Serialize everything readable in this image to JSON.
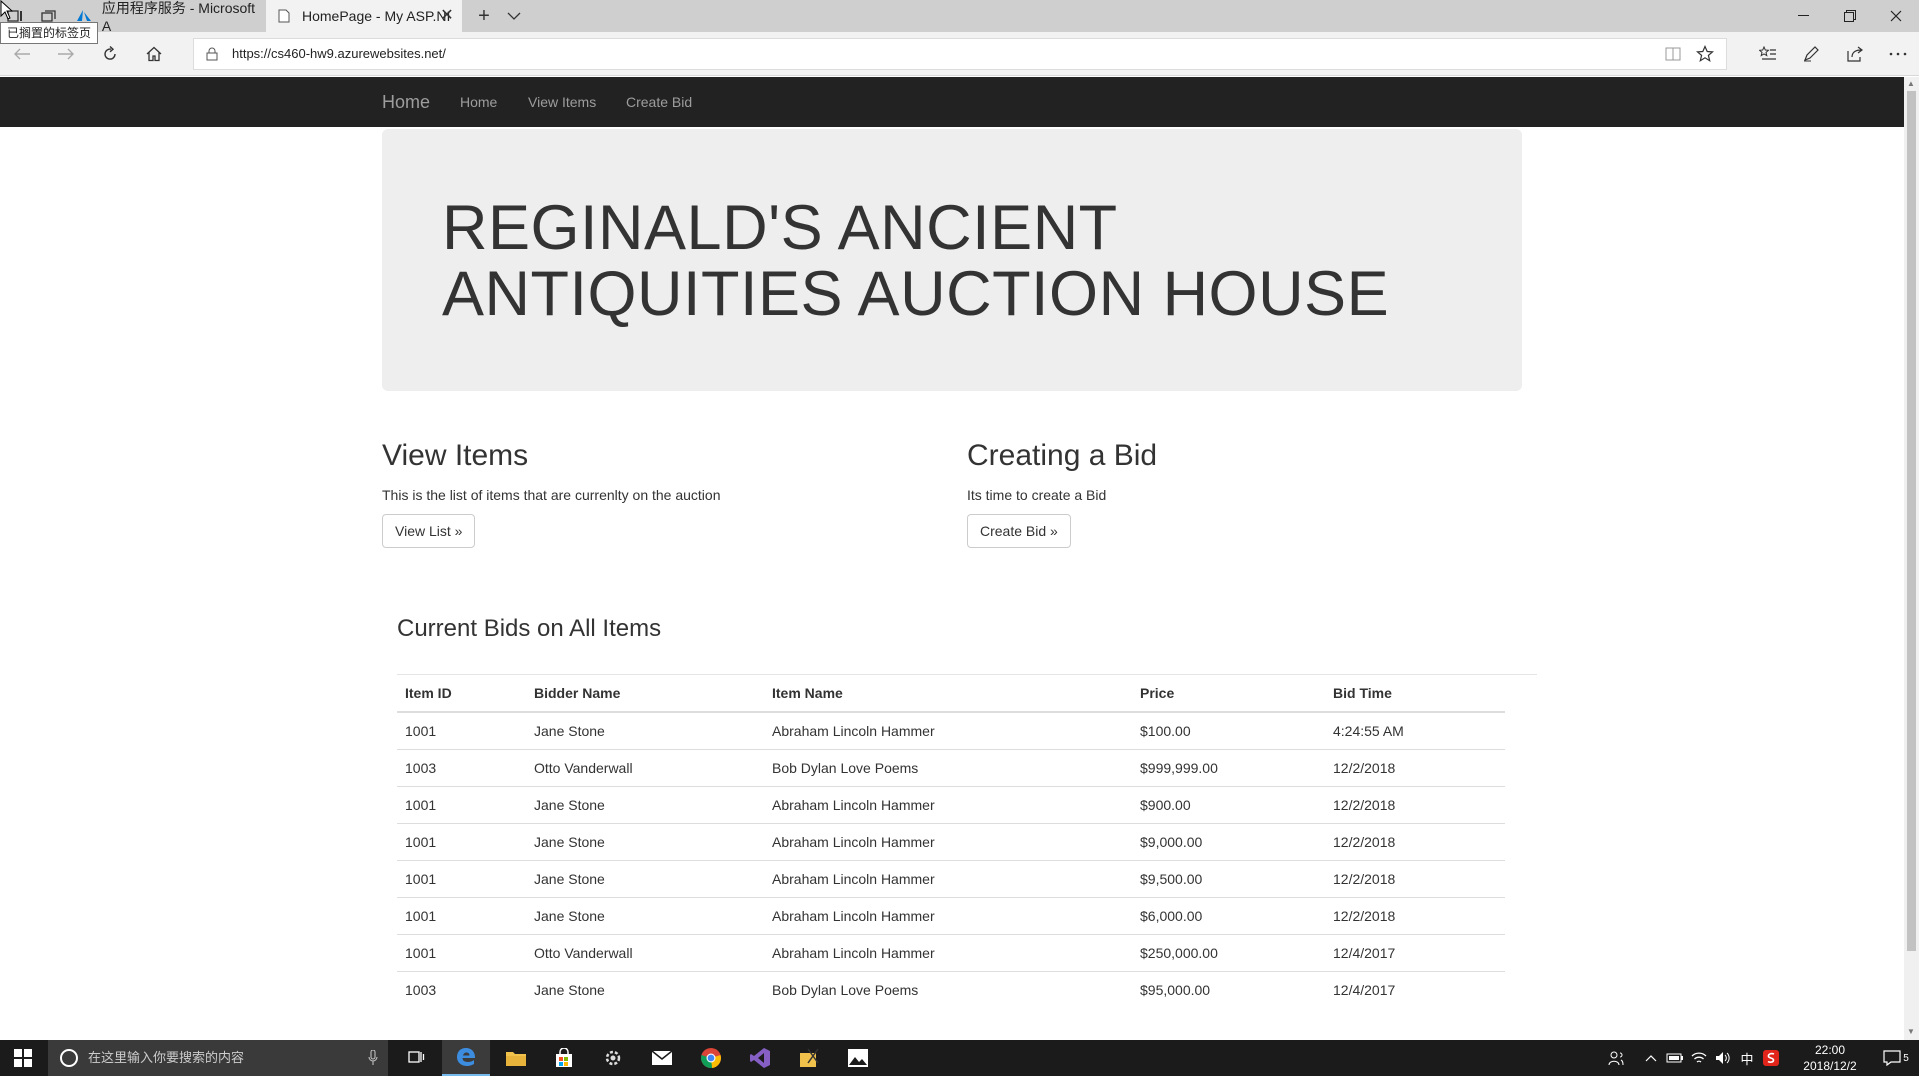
{
  "browser": {
    "tooltip": "已搁置的标签页",
    "tabs": [
      {
        "title": "应用程序服务 - Microsoft A",
        "icon": "azure-icon",
        "active": false
      },
      {
        "title": "HomePage - My ASP.NI",
        "icon": "page-icon",
        "active": true
      }
    ],
    "url": "https://cs460-hw9.azurewebsites.net/"
  },
  "site": {
    "brand": "Home",
    "nav_links": [
      "Home",
      "View Items",
      "Create Bid"
    ],
    "jumbotron_title": "REGINALD'S ANCIENT ANTIQUITIES AUCTION HOUSE",
    "view_items": {
      "heading": "View Items",
      "text": "This is the list of items that are currenlty on the auction",
      "button": "View List »"
    },
    "creating_bid": {
      "heading": "Creating a Bid",
      "text": "Its time to create a Bid",
      "button": "Create Bid »"
    },
    "bids": {
      "title": "Current Bids on All Items",
      "headers": [
        "Item ID",
        "Bidder Name",
        "Item Name",
        "Price",
        "Bid Time"
      ],
      "rows": [
        [
          "1001",
          "Jane Stone",
          "Abraham Lincoln Hammer",
          "$100.00",
          "4:24:55 AM"
        ],
        [
          "1003",
          "Otto Vanderwall",
          "Bob Dylan Love Poems",
          "$999,999.00",
          "12/2/2018"
        ],
        [
          "1001",
          "Jane Stone",
          "Abraham Lincoln Hammer",
          "$900.00",
          "12/2/2018"
        ],
        [
          "1001",
          "Jane Stone",
          "Abraham Lincoln Hammer",
          "$9,000.00",
          "12/2/2018"
        ],
        [
          "1001",
          "Jane Stone",
          "Abraham Lincoln Hammer",
          "$9,500.00",
          "12/2/2018"
        ],
        [
          "1001",
          "Jane Stone",
          "Abraham Lincoln Hammer",
          "$6,000.00",
          "12/2/2018"
        ],
        [
          "1001",
          "Otto Vanderwall",
          "Abraham Lincoln Hammer",
          "$250,000.00",
          "12/4/2017"
        ],
        [
          "1003",
          "Jane Stone",
          "Bob Dylan Love Poems",
          "$95,000.00",
          "12/4/2017"
        ]
      ]
    }
  },
  "taskbar": {
    "search_placeholder": "在这里输入你要搜索的内容",
    "ime": "中",
    "time": "22:00",
    "date": "2018/12/2",
    "notifications": "5"
  },
  "colors": {
    "navbar_bg": "#222222",
    "navbar_text": "#9d9d9d",
    "jumbotron_bg": "#eeeeee",
    "taskbar_bg": "#1b1b1b"
  }
}
